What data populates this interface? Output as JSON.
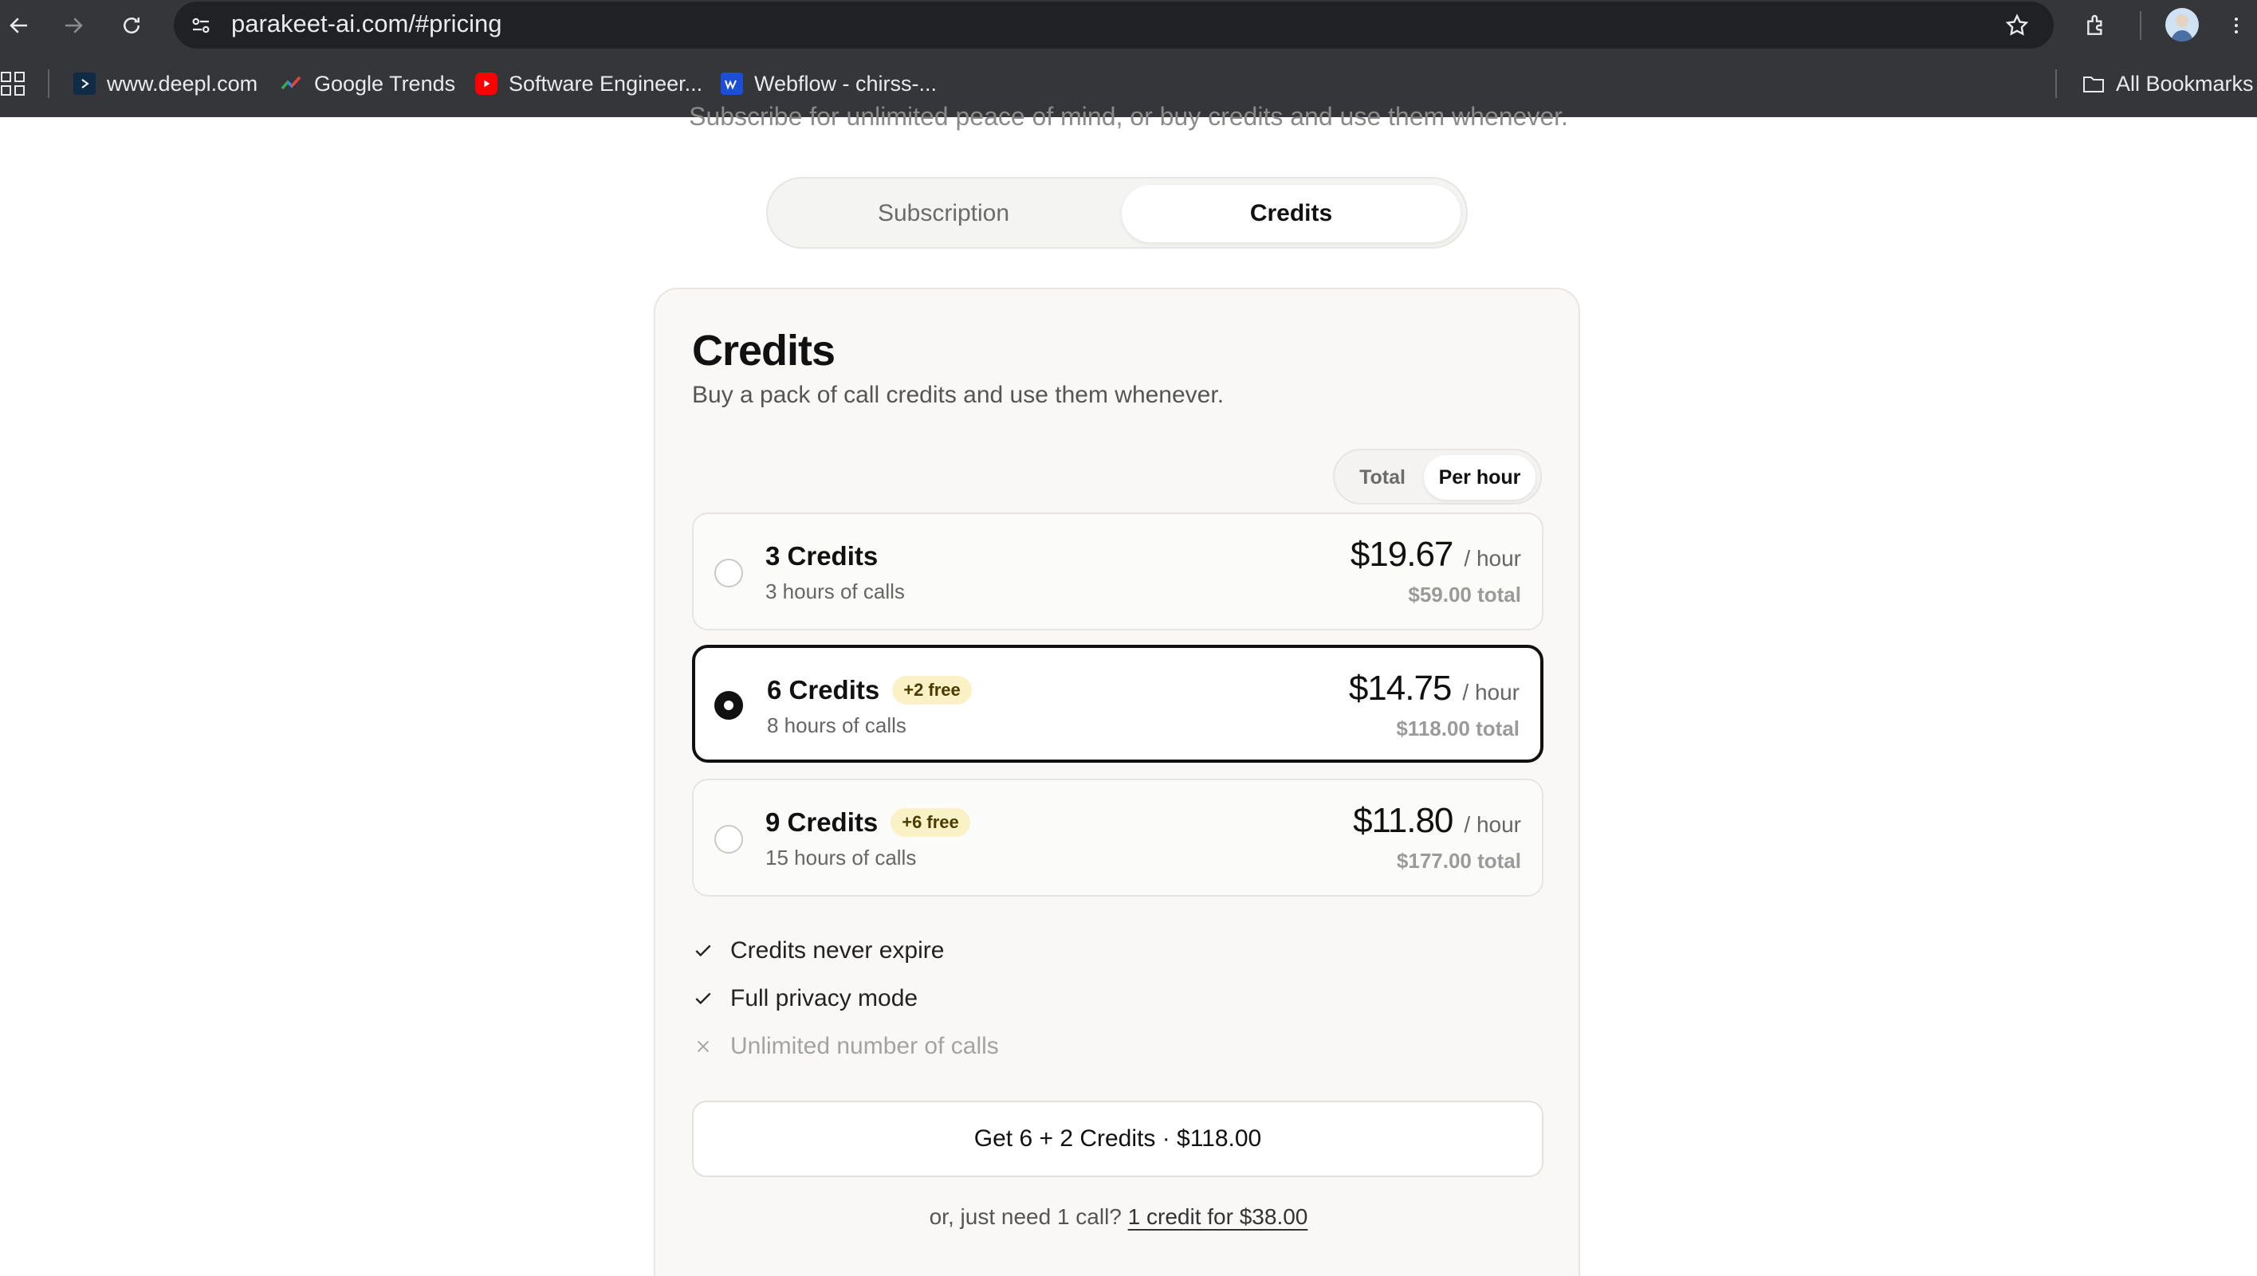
{
  "browser": {
    "url": "parakeet-ai.com/#pricing",
    "bookmarks": [
      {
        "label": "www.deepl.com"
      },
      {
        "label": "Google Trends"
      },
      {
        "label": "Software Engineer..."
      },
      {
        "label": "Webflow - chirss-..."
      }
    ],
    "all_bookmarks": "All Bookmarks"
  },
  "page": {
    "cutoff_text": "Subscribe for unlimited peace of mind, or buy credits and use them whenever.",
    "plan_toggle": {
      "subscription": "Subscription",
      "credits": "Credits",
      "selected": "Credits"
    }
  },
  "card": {
    "title": "Credits",
    "subtitle": "Buy a pack of call credits and use them whenever.",
    "price_toggle": {
      "total": "Total",
      "per_hour": "Per hour",
      "selected": "Per hour"
    },
    "options": [
      {
        "name": "3 Credits",
        "badge": "",
        "desc": "3 hours of calls",
        "price": "$19.67",
        "unit": "/ hour",
        "total": "$59.00 total",
        "selected": false
      },
      {
        "name": "6 Credits",
        "badge": "+2 free",
        "desc": "8 hours of calls",
        "price": "$14.75",
        "unit": "/ hour",
        "total": "$118.00 total",
        "selected": true
      },
      {
        "name": "9 Credits",
        "badge": "+6 free",
        "desc": "15 hours of calls",
        "price": "$11.80",
        "unit": "/ hour",
        "total": "$177.00 total",
        "selected": false
      }
    ],
    "features": [
      {
        "label": "Credits never expire",
        "included": true
      },
      {
        "label": "Full privacy mode",
        "included": true
      },
      {
        "label": "Unlimited number of calls",
        "included": false
      }
    ],
    "cta": "Get 6 + 2 Credits · $118.00",
    "footer_prefix": "or, just need 1 call?",
    "footer_link": "1 credit for $38.00"
  },
  "colors": {
    "chrome": "#35363a",
    "card_bg": "#f9f8f6",
    "badge_bg": "#fbf1c7",
    "selected_border": "#111111"
  }
}
